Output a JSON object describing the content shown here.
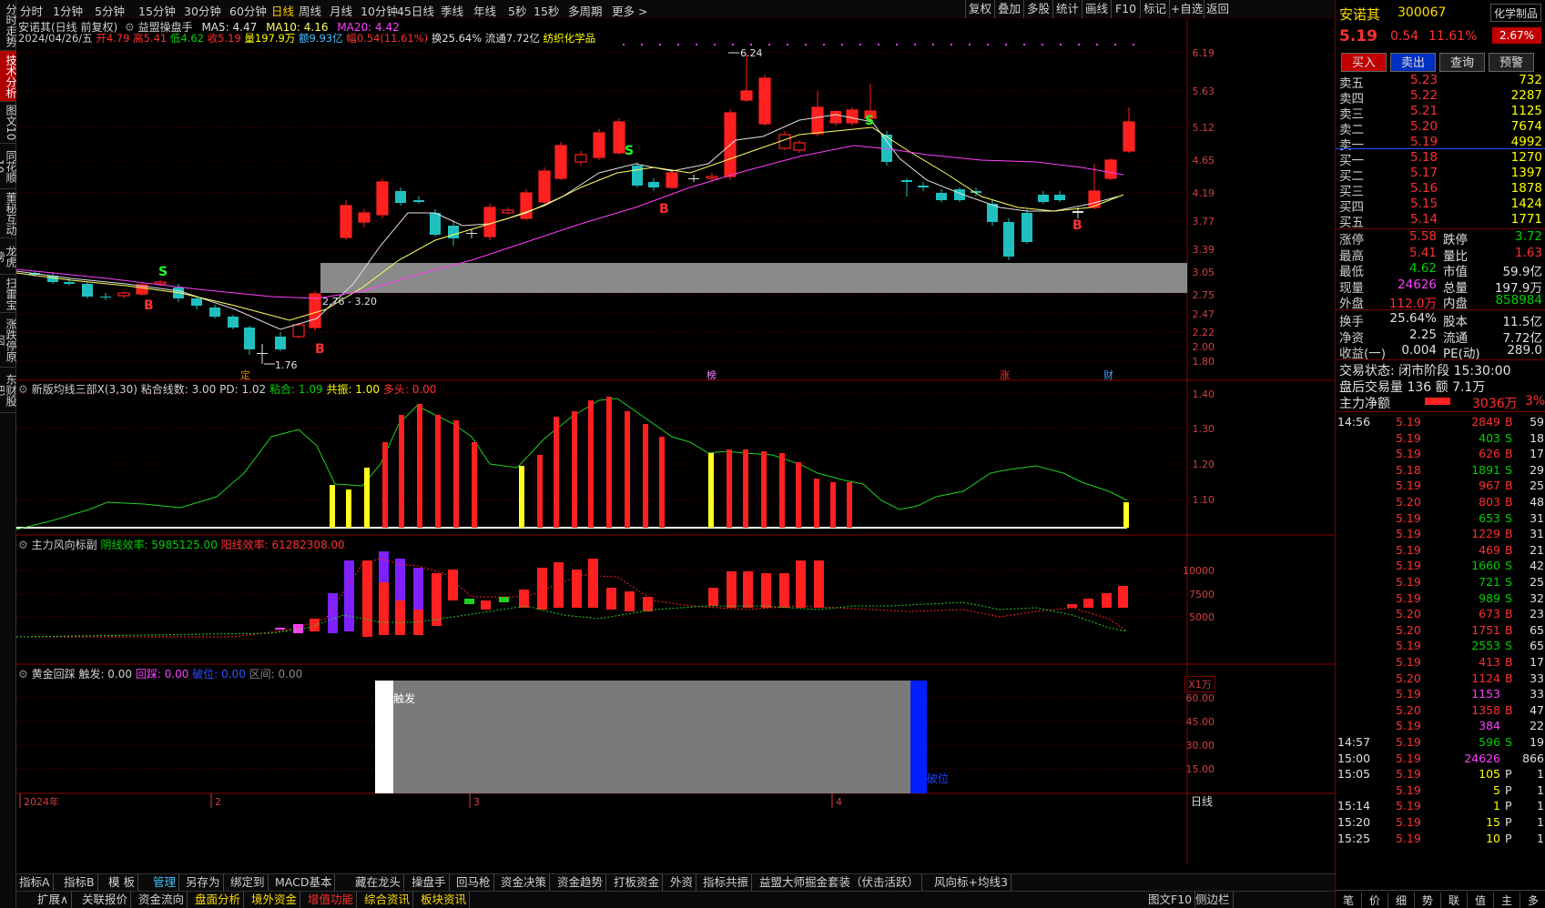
{
  "leftbar": {
    "tabs": [
      {
        "label": "分时走势"
      },
      {
        "label": "技术分析"
      },
      {
        "label": "图文10"
      },
      {
        "label": "同花顺10"
      },
      {
        "label": "董秘互动"
      },
      {
        "label": "龙虎榜"
      },
      {
        "label": "扫雷宝"
      },
      {
        "label": "涨跌停原因"
      },
      {
        "label": "东财股吧"
      }
    ]
  },
  "period_tabs": [
    "分时",
    "1分钟",
    "5分钟",
    "15分钟",
    "30分钟",
    "60分钟",
    "日线",
    "周线",
    "月线",
    "10分钟",
    "45日线",
    "季线",
    "年线",
    "5秒",
    "15秒",
    "多周期",
    "更多 >"
  ],
  "active_period": "日线",
  "toolbar_right": [
    "复权",
    "叠加",
    "多股",
    "统计",
    "画线",
    "F10",
    "标记",
    "+自选",
    "返回"
  ],
  "main_legend": {
    "name": "安诺其(日线 前复权)",
    "indicator": "益盟操盘手",
    "ma5": "MA5: 4.47",
    "ma10": "MA10: 4.16",
    "ma20": "MA20: 4.42"
  },
  "bar_info": {
    "date": "2024/04/26/五",
    "open": "开4.79",
    "high": "高5.41",
    "low": "低4.62",
    "close": "收5.19",
    "volume": "量197.9万",
    "amount": "额9.93亿",
    "change": "幅0.54(11.61%)",
    "turnover": "换25.64%",
    "float": "流通7.72亿",
    "industry": "纺织化学品"
  },
  "main_axis": [
    "6.19",
    "5.63",
    "5.12",
    "4.65",
    "4.19",
    "3.77",
    "3.39",
    "3.05",
    "2.75",
    "2.47",
    "2.22",
    "2.00",
    "1.80"
  ],
  "annotations": {
    "high": "6.24",
    "low": "1.76",
    "range": "2.76 - 3.20",
    "b_marks": [
      "B",
      "B",
      "B",
      "B"
    ],
    "s_marks": [
      "S",
      "S",
      "S"
    ],
    "event_tags": [
      "定",
      "榜",
      "涨",
      "财"
    ]
  },
  "panel2": {
    "title": "新版均线三部X(3,30)",
    "l1": "粘合线数: 3.00",
    "l2": "PD: 1.02",
    "l3": "粘合: 1.09",
    "l4": "共振: 1.00",
    "l5": "多头: 0.00",
    "axis": [
      "1.40",
      "1.30",
      "1.20",
      "1.10"
    ]
  },
  "panel3": {
    "title": "主力风向标副",
    "yin": "阴线效率: 5985125.00",
    "yang": "阳线效率: 61282308.00",
    "axis": [
      "10000",
      "7500",
      "5000"
    ],
    "unit": "X1万"
  },
  "panel4": {
    "title": "黄金回踩",
    "l1": "触发: 0.00",
    "l2": "回踩: 0.00",
    "l3": "破位: 0.00",
    "l4": "区间: 0.00",
    "axis": [
      "60.00",
      "45.00",
      "30.00",
      "15.00"
    ],
    "box_left": "触发",
    "box_right": "破位"
  },
  "xaxis": {
    "labels": [
      "2024年",
      "2",
      "3",
      "4"
    ],
    "period": "日线"
  },
  "bottom_tabs1": [
    "指标A",
    "指标B",
    "模 板",
    "管理",
    "另存为",
    "绑定到",
    "MACD基本",
    "藏在龙头",
    "操盘手",
    "回马枪",
    "资金决策",
    "资金趋势",
    "打板资金",
    "外资",
    "指标共振",
    "益盟大师掘金套装（伏击活跃）",
    "风向标+均线3"
  ],
  "bottom_tabs2": [
    "扩展∧",
    "关联报价",
    "资金流向",
    "盘面分析",
    "境外资金",
    "增值功能",
    "综合资讯",
    "板块资讯"
  ],
  "bottom_right": [
    "图文F10",
    "侧边栏"
  ],
  "quote": {
    "name": "安诺其",
    "code": "300067",
    "tag": "化学制品",
    "price": "5.19",
    "chg": "0.54",
    "pct": "11.61%",
    "pct2": "2.67%",
    "btns": [
      "买入",
      "卖出",
      "查询",
      "预警"
    ]
  },
  "asks": [
    {
      "l": "卖五",
      "p": "5.23",
      "v": "732"
    },
    {
      "l": "卖四",
      "p": "5.22",
      "v": "2287"
    },
    {
      "l": "卖三",
      "p": "5.21",
      "v": "1125"
    },
    {
      "l": "卖二",
      "p": "5.20",
      "v": "7674"
    },
    {
      "l": "卖一",
      "p": "5.19",
      "v": "4992"
    }
  ],
  "bids": [
    {
      "l": "买一",
      "p": "5.18",
      "v": "1270"
    },
    {
      "l": "买二",
      "p": "5.17",
      "v": "1397"
    },
    {
      "l": "买三",
      "p": "5.16",
      "v": "1878"
    },
    {
      "l": "买四",
      "p": "5.15",
      "v": "1424"
    },
    {
      "l": "买五",
      "p": "5.14",
      "v": "1771"
    }
  ],
  "stats": [
    {
      "a": "涨停",
      "av": "5.58",
      "b": "跌停",
      "bv": "3.72"
    },
    {
      "a": "最高",
      "av": "5.41",
      "b": "量比",
      "bv": "1.63"
    },
    {
      "a": "最低",
      "av": "4.62",
      "b": "市值",
      "bv": "59.9亿"
    },
    {
      "a": "现量",
      "av": "24626",
      "b": "总量",
      "bv": "197.9万"
    },
    {
      "a": "外盘",
      "av": "112.0万",
      "b": "内盘",
      "bv": "858984"
    }
  ],
  "stats2": [
    {
      "a": "换手",
      "av": "25.64%",
      "b": "股本",
      "bv": "11.5亿"
    },
    {
      "a": "净资",
      "av": "2.25",
      "b": "流通",
      "bv": "7.72亿"
    },
    {
      "a": "收益(一)",
      "av": "0.004",
      "b": "PE(动)",
      "bv": "289.0"
    }
  ],
  "trade_state": {
    "l1": "交易状态: 闭市阶段 15:30:00",
    "l2": "盘后交易量 136 额 7.1万",
    "l3": "主力净额",
    "l3v": "3036万",
    "l3p": "3%"
  },
  "ticks": [
    {
      "t": "14:56",
      "p": "5.19",
      "v": "2849",
      "d": "B",
      "n": "59"
    },
    {
      "t": "",
      "p": "5.19",
      "v": "403",
      "d": "S",
      "n": "18"
    },
    {
      "t": "",
      "p": "5.19",
      "v": "626",
      "d": "B",
      "n": "17"
    },
    {
      "t": "",
      "p": "5.18",
      "v": "1891",
      "d": "S",
      "n": "29"
    },
    {
      "t": "",
      "p": "5.19",
      "v": "967",
      "d": "B",
      "n": "25"
    },
    {
      "t": "",
      "p": "5.20",
      "v": "803",
      "d": "B",
      "n": "48"
    },
    {
      "t": "",
      "p": "5.19",
      "v": "653",
      "d": "S",
      "n": "31"
    },
    {
      "t": "",
      "p": "5.19",
      "v": "1229",
      "d": "B",
      "n": "31"
    },
    {
      "t": "",
      "p": "5.19",
      "v": "469",
      "d": "B",
      "n": "21"
    },
    {
      "t": "",
      "p": "5.19",
      "v": "1660",
      "d": "S",
      "n": "42"
    },
    {
      "t": "",
      "p": "5.19",
      "v": "721",
      "d": "S",
      "n": "25"
    },
    {
      "t": "",
      "p": "5.19",
      "v": "989",
      "d": "S",
      "n": "32"
    },
    {
      "t": "",
      "p": "5.20",
      "v": "673",
      "d": "B",
      "n": "23"
    },
    {
      "t": "",
      "p": "5.20",
      "v": "1751",
      "d": "B",
      "n": "65"
    },
    {
      "t": "",
      "p": "5.19",
      "v": "2553",
      "d": "S",
      "n": "65"
    },
    {
      "t": "",
      "p": "5.19",
      "v": "413",
      "d": "B",
      "n": "17"
    },
    {
      "t": "",
      "p": "5.20",
      "v": "1124",
      "d": "B",
      "n": "33"
    },
    {
      "t": "",
      "p": "5.19",
      "v": "1153",
      "d": "",
      "n": "33"
    },
    {
      "t": "",
      "p": "5.20",
      "v": "1358",
      "d": "B",
      "n": "47"
    },
    {
      "t": "",
      "p": "5.19",
      "v": "384",
      "d": "",
      "n": "22"
    },
    {
      "t": "14:57",
      "p": "5.19",
      "v": "596",
      "d": "S",
      "n": "19"
    },
    {
      "t": "15:00",
      "p": "5.19",
      "v": "24626",
      "d": "",
      "n": "866"
    },
    {
      "t": "15:05",
      "p": "5.19",
      "v": "105",
      "d": "P",
      "n": "1"
    },
    {
      "t": "",
      "p": "5.19",
      "v": "5",
      "d": "P",
      "n": "1"
    },
    {
      "t": "15:14",
      "p": "5.19",
      "v": "1",
      "d": "P",
      "n": "1"
    },
    {
      "t": "15:20",
      "p": "5.19",
      "v": "15",
      "d": "P",
      "n": "1"
    },
    {
      "t": "15:25",
      "p": "5.19",
      "v": "10",
      "d": "P",
      "n": "1"
    }
  ],
  "right_bottom_tabs": [
    "笔",
    "价",
    "细",
    "势",
    "联",
    "值",
    "主",
    "多"
  ]
}
